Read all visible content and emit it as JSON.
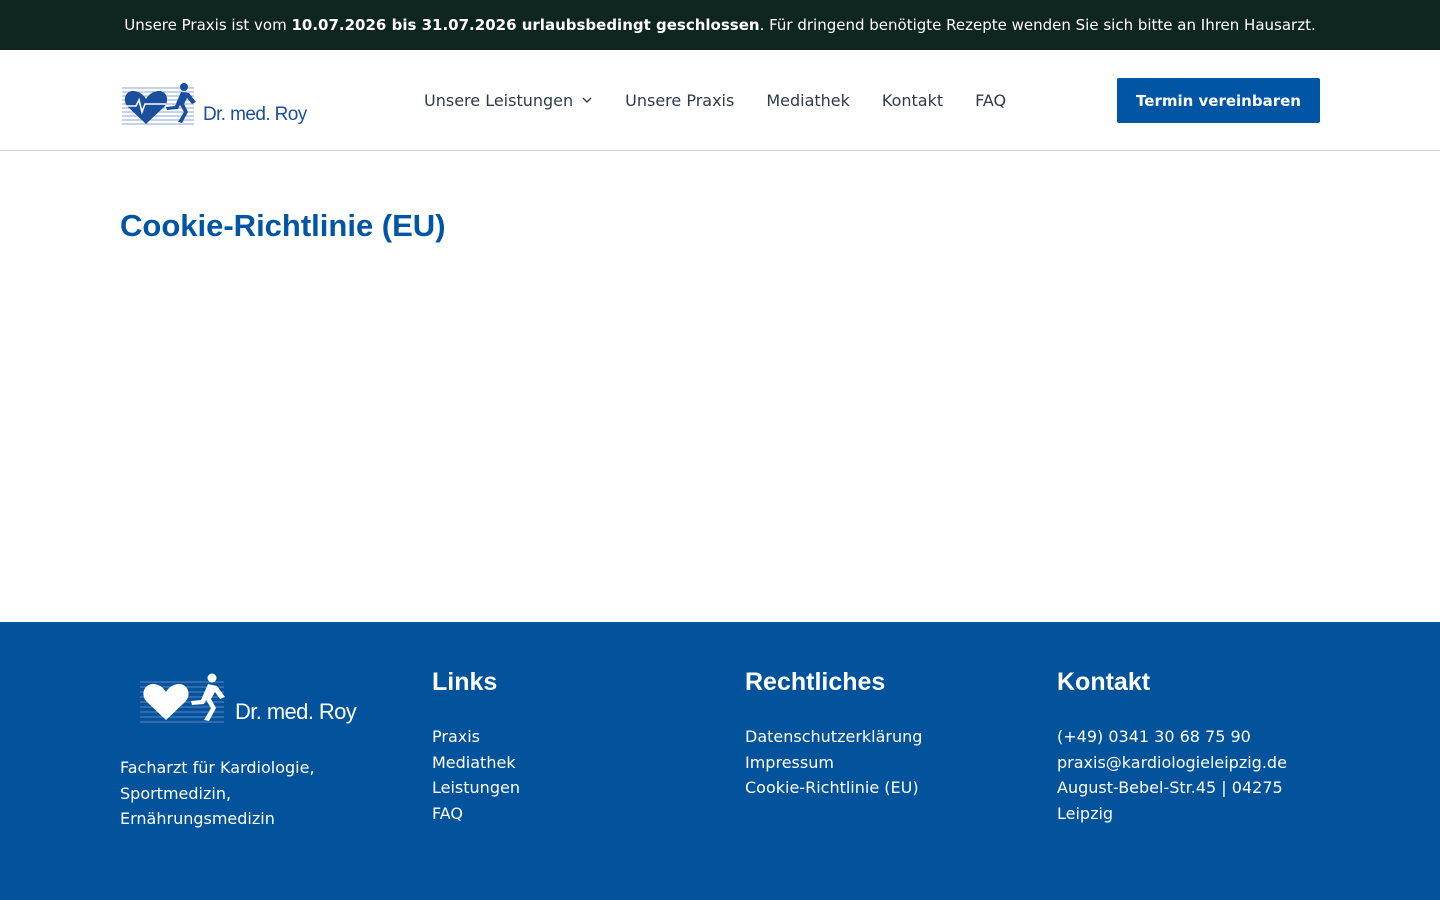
{
  "notice": {
    "prefix": "Unsere Praxis ist vom ",
    "highlight": "10.07.2026 bis 31.07.2026 urlaubsbedingt geschlossen",
    "suffix": ". Für dringend benötigte Rezepte wenden Sie sich bitte an Ihren Hausarzt."
  },
  "header": {
    "logo_text": "Dr. med. Roy",
    "nav": [
      {
        "label": "Unsere Leistungen",
        "icon": "chevron-down-icon"
      },
      {
        "label": "Unsere Praxis"
      },
      {
        "label": "Mediathek"
      },
      {
        "label": "Kontakt"
      },
      {
        "label": "FAQ"
      }
    ],
    "cta_label": "Termin vereinbaren"
  },
  "main": {
    "title": "Cookie-Richtlinie (EU)"
  },
  "footer": {
    "logo_text": "Dr. med. Roy",
    "tagline": "Facharzt für Kardiologie, Sportmedizin, Ernährungsmedizin",
    "links": {
      "heading": "Links",
      "items": [
        "Praxis",
        "Mediathek",
        "Leistungen",
        "FAQ"
      ]
    },
    "legal": {
      "heading": "Rechtliches",
      "items": [
        "Datenschutzerklärung",
        "Impressum",
        "Cookie-Richtlinie (EU)"
      ]
    },
    "contact": {
      "heading": "Kontakt",
      "phone": "(+49) 0341 30 68 75 90",
      "email": "praxis@kardiologieleipzig.de",
      "address_line1": "August-Bebel-Str.45 | 04275",
      "address_line2": "Leipzig"
    }
  },
  "colors": {
    "notice_bg": "#0f2620",
    "brand_blue": "#0055a5",
    "footer_bg": "#02529c"
  }
}
